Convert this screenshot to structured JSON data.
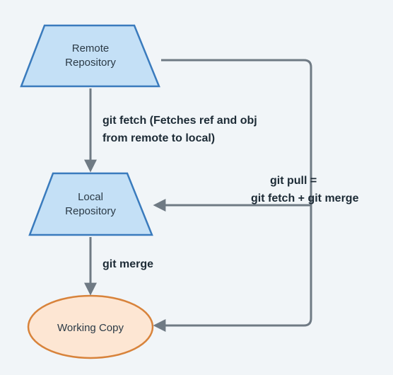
{
  "chart_data": {
    "type": "flow",
    "title": "",
    "nodes": [
      {
        "id": "remote",
        "label_line1": "Remote",
        "label_line2": "Repository",
        "shape": "trapezoid",
        "fill": "#c4e0f6",
        "stroke": "#3a7bbd"
      },
      {
        "id": "local",
        "label_line1": "Local",
        "label_line2": "Repository",
        "shape": "trapezoid",
        "fill": "#c4e0f6",
        "stroke": "#3a7bbd"
      },
      {
        "id": "working",
        "label_line1": "Working Copy",
        "label_line2": "",
        "shape": "ellipse",
        "fill": "#fde6d3",
        "stroke": "#d8833b"
      }
    ],
    "edges": [
      {
        "id": "e_fetch",
        "from": "remote",
        "to": "local",
        "label_line1": "git fetch (Fetches ref and obj",
        "label_line2": "from remote to local)"
      },
      {
        "id": "e_merge",
        "from": "local",
        "to": "working",
        "label_line1": "git merge",
        "label_line2": ""
      },
      {
        "id": "e_pull",
        "from": "remote",
        "to": "working",
        "label_line1": "git pull =",
        "label_line2": "git fetch + git merge"
      },
      {
        "id": "e_pull_to_local",
        "from": "remote",
        "to": "local",
        "label_line1": "",
        "label_line2": ""
      }
    ]
  }
}
